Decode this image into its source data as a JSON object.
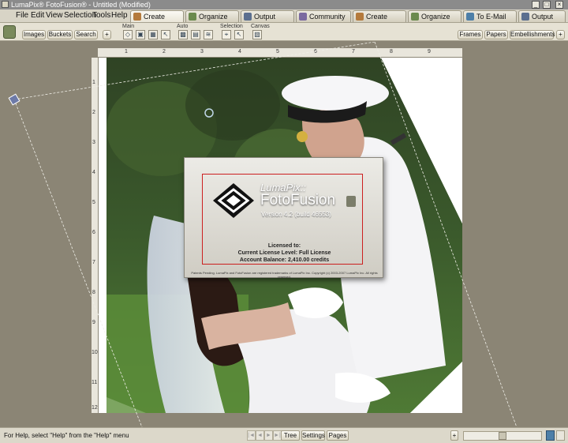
{
  "window": {
    "title": "LumaPix® FotoFusion® - Untitled (Modified)",
    "controls": [
      "_",
      "□",
      "×"
    ]
  },
  "menu": [
    "File",
    "Edit",
    "View",
    "Selection",
    "Tools",
    "Help"
  ],
  "tabs": [
    {
      "label": "Create",
      "active": true
    },
    {
      "label": "Organize",
      "active": false
    },
    {
      "label": "Output",
      "active": false
    },
    {
      "label": "Community",
      "active": false
    },
    {
      "label": "Create",
      "active": false
    },
    {
      "label": "Organize",
      "active": false
    },
    {
      "label": "To E-Mail",
      "active": false
    },
    {
      "label": "Output",
      "active": false
    }
  ],
  "toolbar": {
    "left_buttons": [
      "Images",
      "Buckets",
      "Search",
      "+"
    ],
    "groups": [
      "Main",
      "Auto",
      "Selection",
      "Canvas"
    ],
    "right_buttons": [
      "Frames",
      "Papers",
      "Embellishments",
      "+"
    ]
  },
  "rulers": {
    "top": [
      "1",
      "2",
      "3",
      "4",
      "5",
      "6",
      "7",
      "8",
      "9"
    ],
    "left": [
      "1",
      "2",
      "3",
      "4",
      "5",
      "6",
      "7",
      "8",
      "9",
      "10",
      "11",
      "12"
    ]
  },
  "splash": {
    "brand_small": "LumaPix::",
    "brand_large": "FotoFusion",
    "version": "Version 4.2 (build 46553)",
    "licensed_to": "Licensed to:",
    "license_level": "Current License Level: Full License",
    "balance": "Account Balance: 2,410.00 credits",
    "fineprint": "Patents Pending. LumaPix and FotoFusion are registered trademarks of LumaPix Inc. Copyright (c) 2003-2007 LumaPix Inc. All rights reserved."
  },
  "statusbar": {
    "help_text": "For Help, select \"Help\" from the \"Help\" menu",
    "nav_buttons": [
      "|◄",
      "◄",
      "►",
      "►|"
    ],
    "view_buttons": [
      "Tree",
      "Settings",
      "Pages"
    ],
    "plus": "+"
  },
  "colors": {
    "accent_red": "#cc1f1f",
    "chrome": "#d8d4c6",
    "workspace": "#8b8575"
  }
}
